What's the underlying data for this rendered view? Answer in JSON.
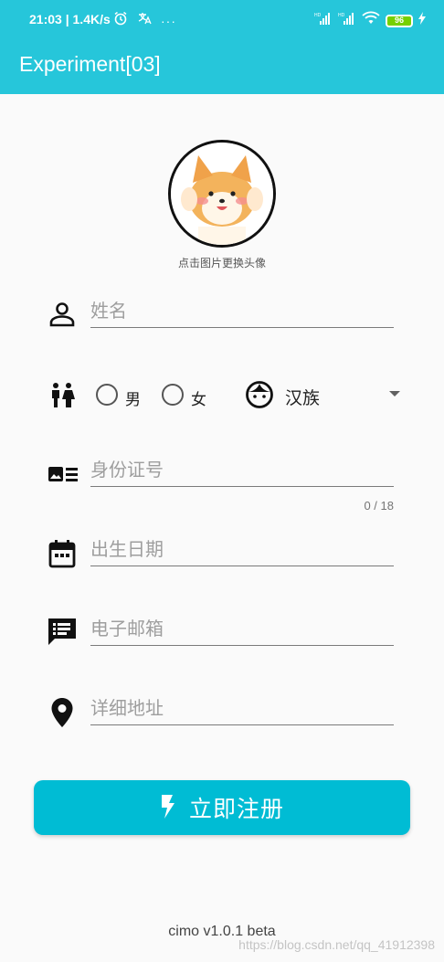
{
  "status_bar": {
    "time": "21:03",
    "speed": "1.4K/s",
    "battery": "96",
    "icons": [
      "alarm-icon",
      "translate-icon",
      "more-icon",
      "signal-hd-icon",
      "signal-hd-icon",
      "wifi-icon",
      "battery-icon",
      "charging-icon"
    ]
  },
  "app_bar": {
    "title": "Experiment[03]",
    "color": "#26c6da"
  },
  "avatar": {
    "hint": "点击图片更换头像"
  },
  "form": {
    "name_placeholder": "姓名",
    "gender_male": "男",
    "gender_female": "女",
    "ethnicity_selected": "汉族",
    "id_placeholder": "身份证号",
    "id_counter": "0 / 18",
    "birthdate_placeholder": "出生日期",
    "email_placeholder": "电子邮箱",
    "address_placeholder": "详细地址"
  },
  "register_button": {
    "label": "立即注册",
    "color": "#00bcd4"
  },
  "footer": {
    "version": "cimo v1.0.1 beta",
    "watermark": "https://blog.csdn.net/qq_41912398"
  }
}
